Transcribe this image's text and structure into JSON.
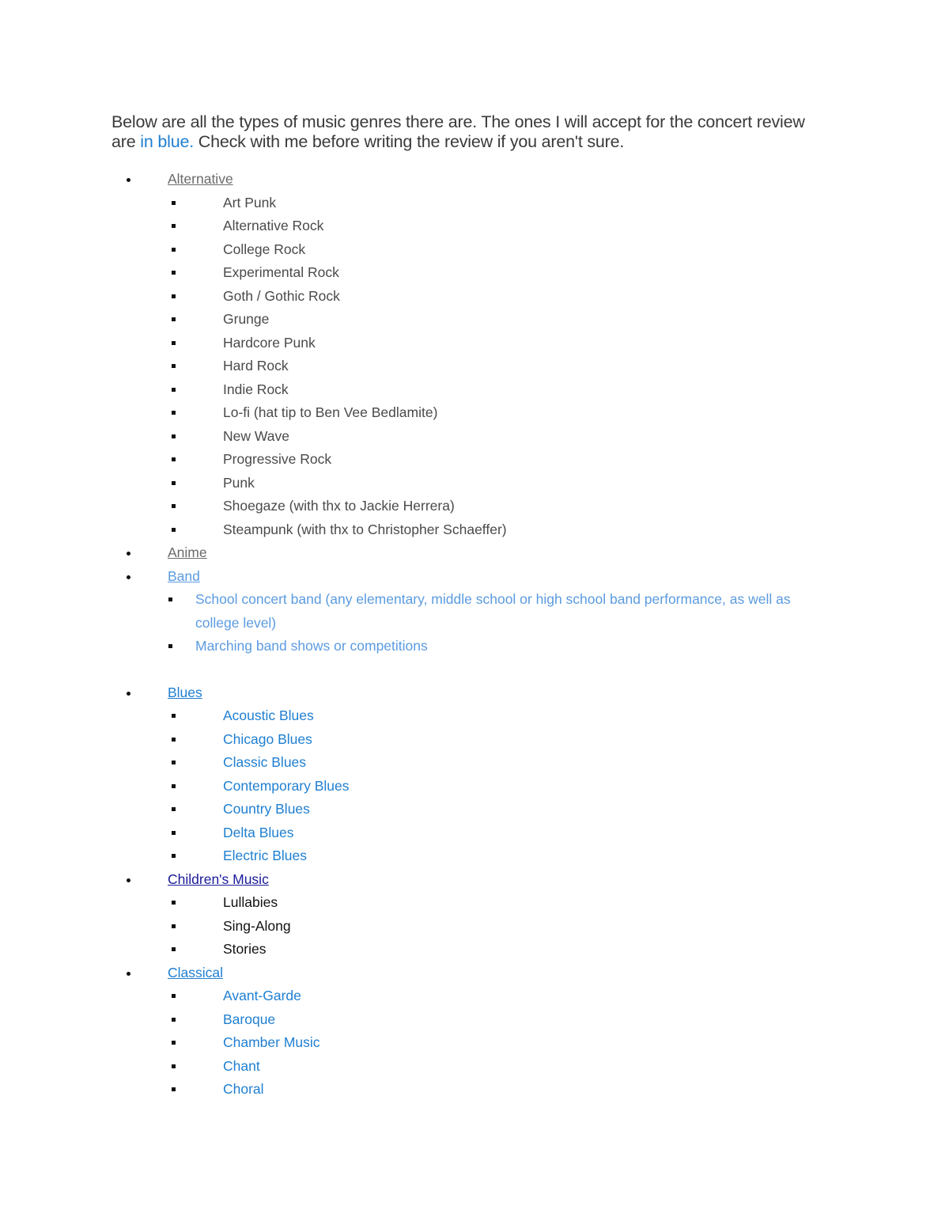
{
  "intro": {
    "part1": "Below are all the types of music genres there are. The ones I will accept for the concert review are ",
    "highlight": "in blue.",
    "part2": " Check with me before writing the review if you aren't sure."
  },
  "colors": {
    "accepted_blue": "#1f7fd1",
    "light_blue": "#5b9be0",
    "not_accepted_gray": "#4a4a4a",
    "visited_link_navy": "#1a1a9a"
  },
  "categories": [
    {
      "label": "Alternative",
      "accepted": false,
      "items": [
        "Art Punk",
        "Alternative Rock",
        "College Rock",
        "Experimental Rock",
        "Goth / Gothic Rock",
        "Grunge",
        "Hardcore Punk",
        "Hard Rock",
        "Indie Rock",
        "Lo-fi (hat tip to Ben Vee Bedlamite)",
        "New Wave",
        "Progressive Rock",
        "Punk",
        "Shoegaze (with thx to Jackie Herrera)",
        "Steampunk (with thx to Christopher Schaeffer)"
      ]
    },
    {
      "label": "Anime",
      "accepted": false,
      "items": []
    },
    {
      "label": "Band",
      "accepted": true,
      "items": [
        "School concert band (any elementary, middle school or high school band performance, as well as college level)",
        "Marching band shows or competitions"
      ]
    },
    {
      "label": "Blues",
      "accepted": true,
      "items": [
        "Acoustic Blues",
        "Chicago Blues",
        "Classic Blues",
        "Contemporary Blues",
        "Country Blues",
        "Delta Blues",
        "Electric Blues"
      ]
    },
    {
      "label": "Children's Music",
      "accepted": false,
      "items": [
        "Lullabies",
        "Sing-Along",
        "Stories"
      ]
    },
    {
      "label": "Classical",
      "accepted": true,
      "items": [
        "Avant-Garde",
        "Baroque",
        "Chamber Music",
        "Chant",
        "Choral"
      ]
    }
  ]
}
